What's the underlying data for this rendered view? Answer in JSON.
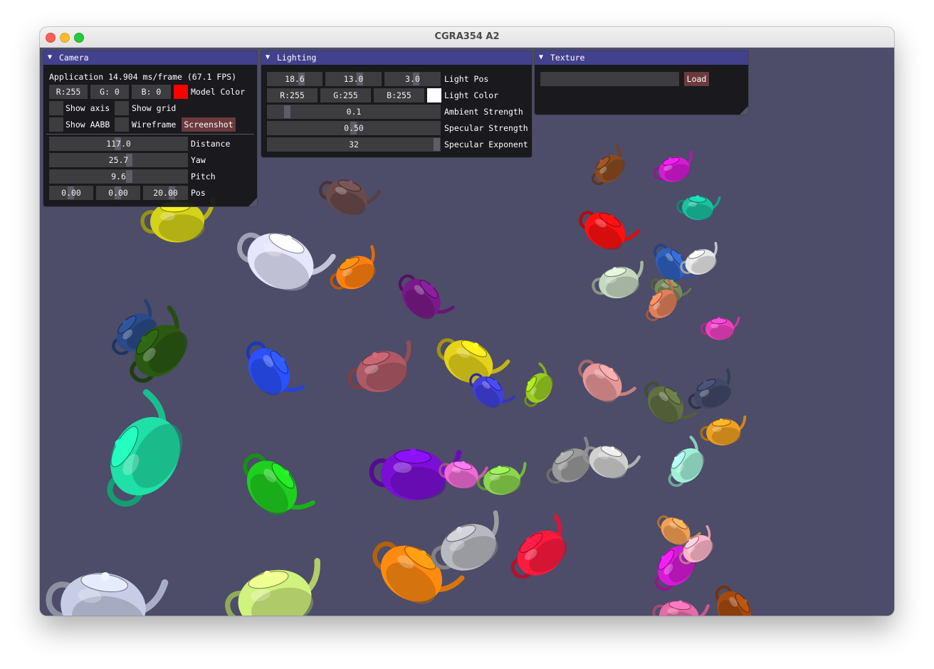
{
  "window": {
    "title": "CGRA354 A2"
  },
  "colors": {
    "background": "#4d4c69",
    "panel_title": "#41418d",
    "model_color": "#ff0000",
    "light_color": "#ffffff",
    "button": "#6b3a3d"
  },
  "camera": {
    "title": "Camera",
    "fps_text": "Application 14.904 ms/frame (67.1 FPS)",
    "model_r": "R:255",
    "model_g": "G:  0",
    "model_b": "B:  0",
    "model_color_label": "Model Color",
    "show_axis_label": "Show axis",
    "show_grid_label": "Show grid",
    "show_aabb_label": "Show AABB",
    "wireframe_label": "Wireframe",
    "screenshot_label": "Screenshot",
    "distance_value": "117.0",
    "distance_label": "Distance",
    "yaw_value": "25.7",
    "yaw_label": "Yaw",
    "pitch_value": "9.6",
    "pitch_label": "Pitch",
    "pos_x": "0.00",
    "pos_y": "0.00",
    "pos_z": "20.00",
    "pos_label": "Pos"
  },
  "lighting": {
    "title": "Lighting",
    "pos_x": "18.6",
    "pos_y": "13.0",
    "pos_z": "3.0",
    "light_pos_label": "Light Pos",
    "color_r": "R:255",
    "color_g": "G:255",
    "color_b": "B:255",
    "light_color_label": "Light Color",
    "ambient_value": "0.1",
    "ambient_label": "Ambient Strength",
    "specular_value": "0.50",
    "specular_label": "Specular Strength",
    "exponent_value": "32",
    "exponent_label": "Specular Exponent"
  },
  "texture": {
    "title": "Texture",
    "path_value": "",
    "load_label": "Load"
  },
  "teapots": [
    {
      "color": "#1fe0a6"
    },
    {
      "color": "#d0f27e"
    },
    {
      "color": "#ff8a10"
    },
    {
      "color": "#ff1a3d"
    },
    {
      "color": "#c8cde6"
    },
    {
      "color": "#2a50ff"
    },
    {
      "color": "#b05a66"
    },
    {
      "color": "#e5d21a"
    },
    {
      "color": "#2a4a88"
    },
    {
      "color": "#7b0fd6"
    },
    {
      "color": "#1fcf1f"
    },
    {
      "color": "#b8b8c0"
    },
    {
      "color": "#e6e6ff"
    },
    {
      "color": "#2a5a12"
    },
    {
      "color": "#d4d21a"
    },
    {
      "color": "#7a1a8a"
    },
    {
      "color": "#ff8010"
    },
    {
      "color": "#6a4a4a"
    },
    {
      "color": "#d61ad6"
    },
    {
      "color": "#8ad64e"
    },
    {
      "color": "#e89898"
    },
    {
      "color": "#9a9a9a"
    },
    {
      "color": "#f06ad6"
    },
    {
      "color": "#9acd20"
    },
    {
      "color": "#c5d8c0"
    },
    {
      "color": "#f4a052"
    },
    {
      "color": "#ffb5c8"
    },
    {
      "color": "#e86aa8"
    },
    {
      "color": "#a34a10"
    },
    {
      "color": "#d61ad6"
    },
    {
      "color": "#ff1010"
    },
    {
      "color": "#8a4a20"
    },
    {
      "color": "#1ac0a0"
    },
    {
      "color": "#3060c0"
    },
    {
      "color": "#e8e8e8"
    },
    {
      "color": "#7b8a5a"
    },
    {
      "color": "#e0805a"
    },
    {
      "color": "#f040c0"
    },
    {
      "color": "#607040"
    },
    {
      "color": "#404868"
    },
    {
      "color": "#d0d0d0"
    },
    {
      "color": "#a0f0d8"
    },
    {
      "color": "#f0a020"
    },
    {
      "color": "#4040e0"
    },
    {
      "color": "#e8c0a0"
    },
    {
      "color": "#1a2a1a"
    },
    {
      "color": "#d070d0"
    },
    {
      "color": "#a000ff"
    }
  ]
}
